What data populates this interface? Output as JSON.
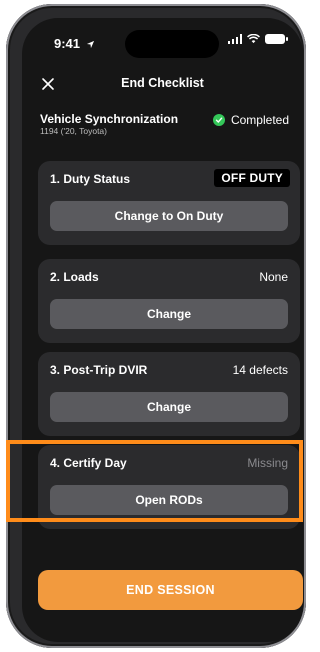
{
  "status_bar": {
    "time": "9:41"
  },
  "header": {
    "title": "End Checklist"
  },
  "vehicle": {
    "name": "Vehicle Synchronization",
    "sub": "1194 ('20, Toyota)",
    "status": "Completed"
  },
  "cards": [
    {
      "label": "1. Duty Status",
      "value": "OFF DUTY",
      "button": "Change to On Duty"
    },
    {
      "label": "2. Loads",
      "value": "None",
      "button": "Change"
    },
    {
      "label": "3. Post-Trip DVIR",
      "value": "14 defects",
      "button": "Change"
    },
    {
      "label": "4. Certify Day",
      "value": "Missing",
      "button": "Open RODs"
    }
  ],
  "footer": {
    "end_session": "END SESSION"
  },
  "colors": {
    "highlight": "#ff8c1a",
    "end_button": "#f29a3e",
    "completed": "#34c759"
  }
}
